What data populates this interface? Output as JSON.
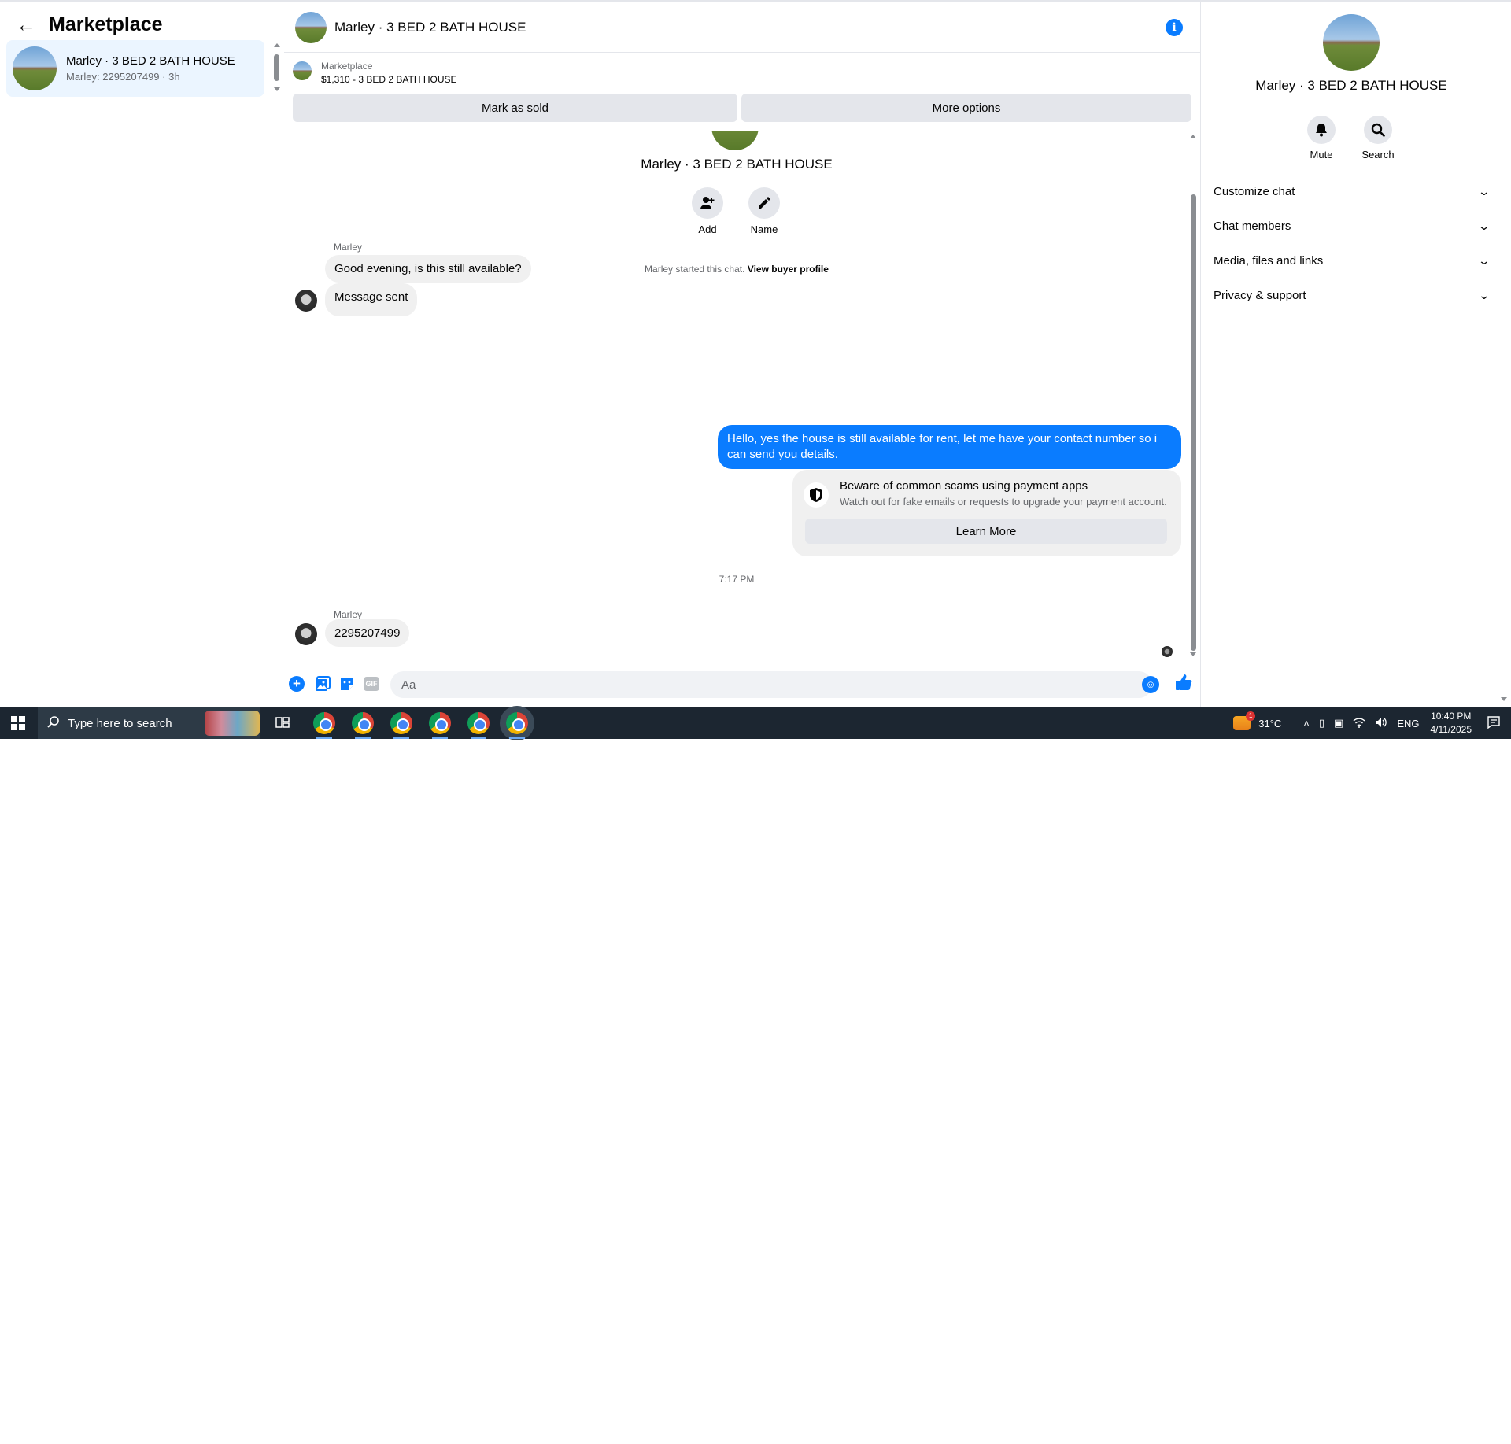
{
  "left_panel": {
    "title": "Marketplace",
    "conversation": {
      "name": "Marley · 3 BED 2 BATH HOUSE",
      "subtitle": "Marley: 2295207499 · 3h"
    }
  },
  "chat_header": {
    "title": "Marley · 3 BED 2 BATH HOUSE"
  },
  "marketplace_bar": {
    "label": "Marketplace",
    "price_title": "$1,310 - 3 BED 2 BATH HOUSE",
    "mark_sold": "Mark as sold",
    "more_options": "More options"
  },
  "thread_intro": {
    "name": "Marley · 3 BED 2 BATH HOUSE",
    "add_label": "Add",
    "name_label": "Name",
    "started_text": "Marley started this chat.",
    "view_profile": "View buyer profile"
  },
  "messages": [
    {
      "sender": "Marley",
      "text": "Good evening, is this still available?"
    },
    {
      "text": "Message sent"
    },
    {
      "text": "Hello, yes the house is still available for rent, let me have your contact number so i can send you details."
    },
    {
      "sender": "Marley",
      "text": "2295207499"
    }
  ],
  "scam_notice": {
    "title": "Beware of common scams using payment apps",
    "subtitle": "Watch out for fake emails or requests to upgrade your payment account.",
    "button": "Learn More"
  },
  "timestamp": "7:17 PM",
  "composer": {
    "placeholder": "Aa"
  },
  "right_panel": {
    "name": "Marley · 3 BED 2 BATH HOUSE",
    "mute_label": "Mute",
    "search_label": "Search",
    "sections": [
      "Customize chat",
      "Chat members",
      "Media, files and links",
      "Privacy & support"
    ]
  },
  "taskbar": {
    "search_placeholder": "Type here to search",
    "temperature": "31°C",
    "language": "ENG",
    "time": "10:40 PM",
    "date": "4/11/2025",
    "weather_badge": "1"
  },
  "colors": {
    "accent": "#0a7cff",
    "selected_bg": "#ebf5ff",
    "bubble_in": "#f0f0f0",
    "taskbar": "#1c2631"
  }
}
